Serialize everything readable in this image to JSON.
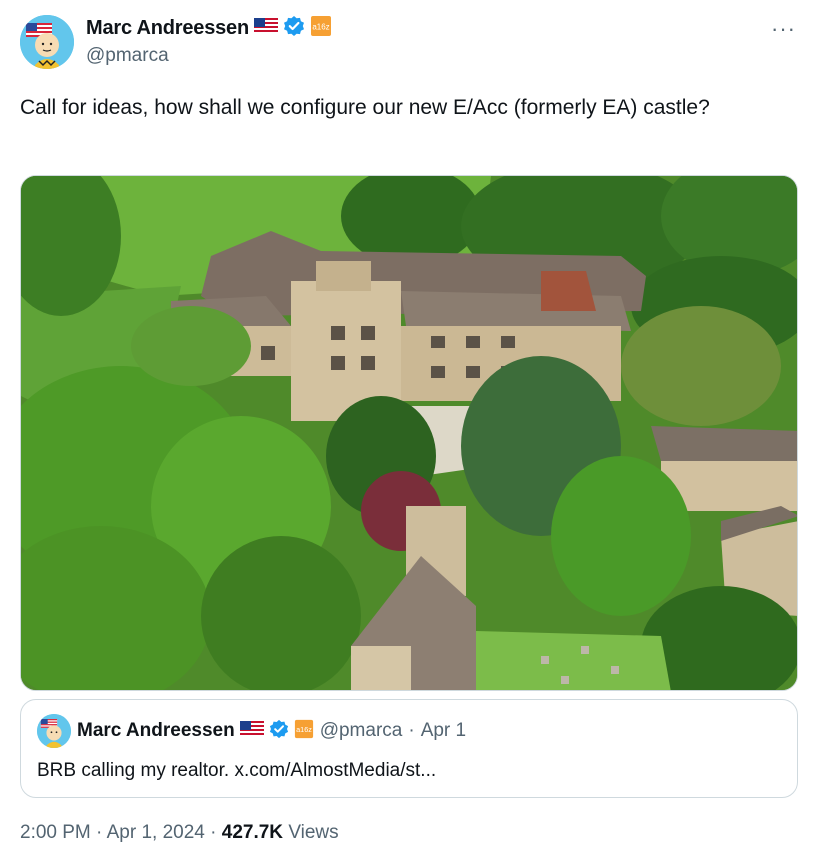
{
  "author": {
    "display_name": "Marc Andreessen",
    "handle": "@pmarca",
    "flag_icon": "us-flag-icon",
    "verified_icon": "verified-badge-icon",
    "affiliate_label": "a16z"
  },
  "more_label": "···",
  "tweet": {
    "text": "Call for ideas, how shall we configure our new E/Acc (formerly EA) castle?"
  },
  "quoted_tweet": {
    "display_name": "Marc Andreessen",
    "handle": "@pmarca",
    "separator": "·",
    "date": "Apr 1",
    "text": "BRB calling my realtor. x.com/AlmostMedia/st..."
  },
  "meta": {
    "time": "2:00 PM",
    "separator": "·",
    "date": "Apr 1, 2024",
    "views_count": "427.7K",
    "views_label": "Views"
  },
  "colors": {
    "verified": "#1d9bf0",
    "affiliate": "#f6a033",
    "secondary_text": "#536471",
    "border": "#cfd9de"
  }
}
